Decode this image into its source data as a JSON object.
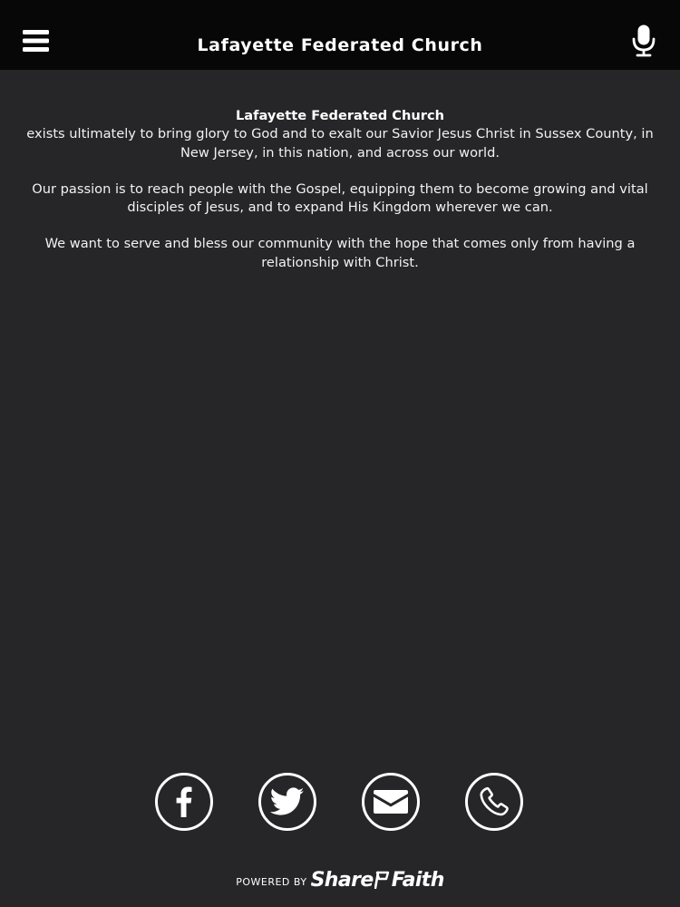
{
  "header": {
    "title": "Lafayette Federated Church",
    "menu_icon": "hamburger-menu-icon",
    "mic_icon": "microphone-icon"
  },
  "content": {
    "church_name": "Lafayette Federated Church",
    "paragraph_1": "exists ultimately to bring glory to God and to exalt our Savior Jesus Christ in Sussex County, in New Jersey, in this nation, and across our world.",
    "paragraph_2": "Our passion is to reach people with the Gospel, equipping them to become growing and vital disciples of Jesus, and to expand His Kingdom wherever we can.",
    "paragraph_3": "We want to serve and bless our community with the hope that comes only from having a relationship with Christ."
  },
  "social": [
    {
      "name": "facebook",
      "icon": "facebook-icon"
    },
    {
      "name": "twitter",
      "icon": "twitter-icon"
    },
    {
      "name": "email",
      "icon": "envelope-icon"
    },
    {
      "name": "phone",
      "icon": "phone-icon"
    }
  ],
  "footer": {
    "powered_by": "POWERED BY",
    "brand_part_1": "Share",
    "brand_part_2": "Faith"
  },
  "colors": {
    "background": "#262527",
    "topbar": "#070707",
    "text": "#ffffff"
  }
}
